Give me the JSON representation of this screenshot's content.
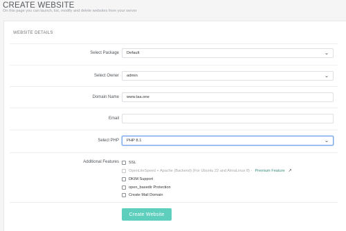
{
  "page": {
    "title": "CREATE WEBSITE",
    "subtitle": "On this page you can launch, list, modify and delete websites from your server"
  },
  "card": {
    "header": "WEBSITE DETAILS"
  },
  "form": {
    "package": {
      "label": "Select Package",
      "value": "Default"
    },
    "owner": {
      "label": "Select Owner",
      "value": "admin"
    },
    "domain": {
      "label": "Domain Name",
      "value": "www.laa.one"
    },
    "email": {
      "label": "Email",
      "value": ""
    },
    "php": {
      "label": "Select PHP",
      "value": "PHP 8.1"
    },
    "features": {
      "label": "Additional Features",
      "items": [
        {
          "label": "SSL",
          "checked": false,
          "disabled": false
        },
        {
          "label": "OpenLiteSpeed + Apache (Backend) (For Ubuntu 22 and AlmaLinux 8) - ",
          "premium": "Premium Feature",
          "checked": false,
          "disabled": true
        },
        {
          "label": "DKIM Support",
          "checked": false,
          "disabled": false
        },
        {
          "label": "open_basedir Protection",
          "checked": false,
          "disabled": false
        },
        {
          "label": "Create Mail Domain",
          "checked": false,
          "disabled": false
        }
      ]
    },
    "submit_label": "Create Website"
  },
  "icons": {
    "select_chevron": "chevron-down-icon",
    "external_link": "external-link-icon"
  },
  "colors": {
    "accent_button": "#5ecfbd",
    "premium_link": "#3b8f7f",
    "focus_border": "#7aa7f0"
  }
}
